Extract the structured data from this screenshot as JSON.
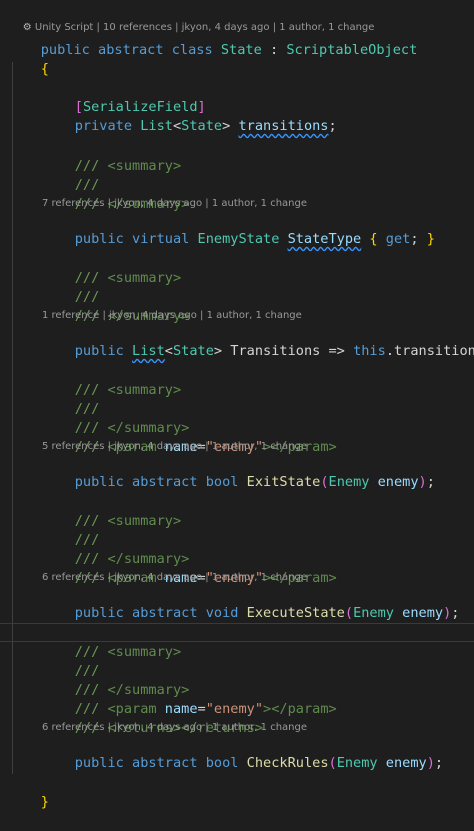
{
  "codelens": {
    "class": {
      "icon": "unity-icon",
      "text": "Unity Script | 10 references | jkyon, 4 days ago | 1 author, 1 change"
    },
    "state_type": "7 references | jkyon, 4 days ago | 1 author, 1 change",
    "transitions_prop": "1 reference | jkyon, 4 days ago | 1 author, 1 change",
    "exit_state": "5 references | jkyon, 4 days ago | 1 author, 1 change",
    "execute_state": "6 references | jkyon, 4 days ago | 1 author, 1 change",
    "check_rules": "6 references | jkyon, 4 days ago | 1 author, 1 change"
  },
  "code": {
    "class_decl": {
      "public": "public",
      "abstract": "abstract",
      "class": "class",
      "name": "State",
      "colon": ":",
      "base": "ScriptableObject"
    },
    "open_brace": "{",
    "close_brace": "}",
    "serialize_field": {
      "open": "[",
      "name": "SerializeField",
      "close": "]"
    },
    "field": {
      "private": "private",
      "list": "List",
      "lt": "<",
      "type": "State",
      "gt": ">",
      "name": "transitions",
      "semi": ";"
    },
    "doc": {
      "slashes": "///",
      "summary_open": "<summary>",
      "summary_close": "</summary>",
      "param_open": "<param",
      "name_attr": "name",
      "eq": "=",
      "enemy_str": "\"enemy\"",
      "param_end": "></param>",
      "returns": "<returns></returns>"
    },
    "state_type": {
      "public": "public",
      "virtual": "virtual",
      "type": "EnemyState",
      "name": "StateType",
      "lbrace": "{",
      "get": "get",
      "semi": ";",
      "rbrace": "}"
    },
    "transitions_prop": {
      "public": "public",
      "list": "List",
      "lt": "<",
      "type": "State",
      "gt": ">",
      "name": "Transitions",
      "arrow": "=>",
      "this": "this",
      "rest": ".transitions;"
    },
    "exit_state": {
      "public": "public",
      "abstract": "abstract",
      "ret": "bool",
      "name": "ExitState",
      "lp": "(",
      "ptype": "Enemy",
      "pname": "enemy",
      "rp": ")",
      "semi": ";"
    },
    "execute_state": {
      "public": "public",
      "abstract": "abstract",
      "ret": "void",
      "name": "ExecuteState",
      "lp": "(",
      "ptype": "Enemy",
      "pname": "enemy",
      "rp": ")",
      "semi": ";"
    },
    "check_rules": {
      "public": "public",
      "abstract": "abstract",
      "ret": "bool",
      "name": "CheckRules",
      "lp": "(",
      "ptype": "Enemy",
      "pname": "enemy",
      "rp": ")",
      "semi": ";"
    }
  },
  "colors": {
    "background": "#1e1e1e",
    "keyword": "#569cd6",
    "type": "#4ec9b0",
    "method": "#dcdcaa",
    "comment": "#6a9955",
    "string": "#ce9178",
    "identifier": "#9cdcfe"
  }
}
